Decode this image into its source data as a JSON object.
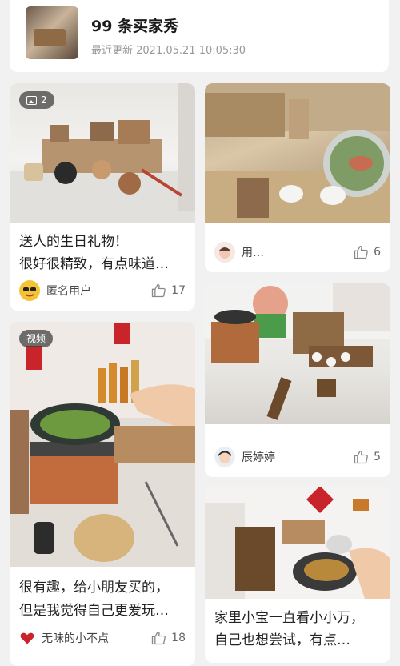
{
  "header": {
    "title": "99 条买家秀",
    "subtitle": "最近更新 2021.05.21 10:05:30"
  },
  "posts": [
    {
      "badge": "2",
      "caption_line1": "送人的生日礼物！",
      "caption_line2": "很好很精致，有点味道…",
      "user": "匿名用户",
      "likes": "17"
    },
    {
      "user": "用…",
      "likes": "6"
    },
    {
      "user": "辰婷婷",
      "likes": "5"
    },
    {
      "badge": "视频",
      "caption_line1": "很有趣，给小朋友买的，",
      "caption_line2": "但是我觉得自己更爱玩…",
      "user": "无味的小不点",
      "likes": "18"
    },
    {
      "caption_line1": "家里小宝一直看小小万，",
      "caption_line2": "自己也想尝试，有点…"
    }
  ]
}
